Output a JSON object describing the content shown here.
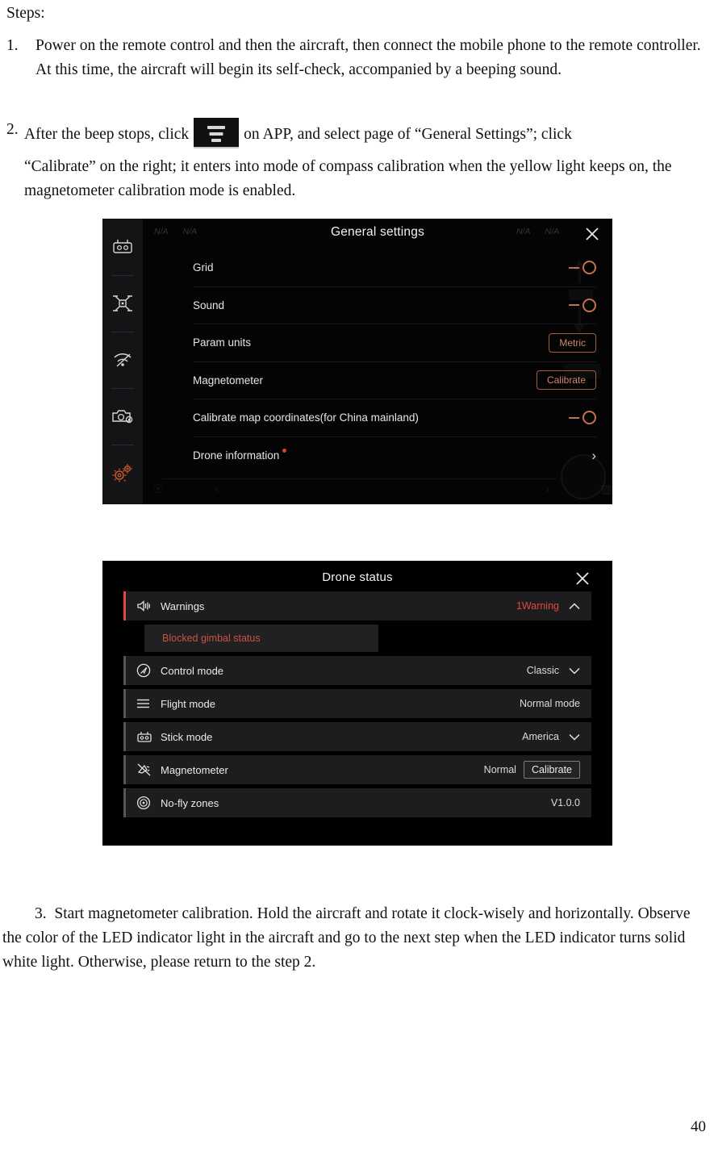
{
  "document": {
    "steps_heading": "Steps:",
    "step1": {
      "number": "1.",
      "text": "Power on the remote control and then the aircraft, then connect the mobile phone to the remote controller. At this time, the aircraft will begin its self-check, accompanied by a beeping sound."
    },
    "step2": {
      "number": "2.",
      "text_before_icon": "After the beep stops, click",
      "icon_name": "app-menu-icon",
      "text_after_icon": "on APP, and select page of “General Settings”; click",
      "line2": "“Calibrate” on the right; it enters into mode of compass calibration when the yellow light keeps on, the magnetometer calibration mode is enabled."
    },
    "step3": {
      "number": "3.",
      "text": "Start magnetometer calibration. Hold the aircraft and rotate it clock-wisely and horizontally. Observe the color of the LED indicator light in the aircraft and go to the next step when the LED indicator turns solid white light. Otherwise, please return to the step 2."
    },
    "page_number": "40"
  },
  "general_settings": {
    "title": "General settings",
    "close_label": "✕",
    "hud": {
      "status_items": [
        "N/A",
        "N/A",
        "N/A",
        "N/A"
      ]
    },
    "sidebar": [
      {
        "name": "remote-controller-icon",
        "active": false
      },
      {
        "name": "aircraft-icon",
        "active": false
      },
      {
        "name": "transmission-icon",
        "active": false
      },
      {
        "name": "camera-settings-icon",
        "active": false
      },
      {
        "name": "general-settings-icon",
        "active": true
      }
    ],
    "rows": [
      {
        "label": "Grid",
        "type": "toggle",
        "value": "off"
      },
      {
        "label": "Sound",
        "type": "toggle",
        "value": "off"
      },
      {
        "label": "Param units",
        "type": "pill",
        "value": "Metric"
      },
      {
        "label": "Magnetometer",
        "type": "pill",
        "value": "Calibrate"
      },
      {
        "label": "Calibrate map coordinates(for China mainland)",
        "type": "toggle",
        "value": "off"
      },
      {
        "label": "Drone information",
        "type": "chevron",
        "value": "›",
        "badge": true
      }
    ],
    "accent_color": "#c4704f",
    "badge_color": "#e23b2e"
  },
  "drone_status": {
    "title": "Drone status",
    "close_label": "✕",
    "rows": [
      {
        "label": "Warnings",
        "icon": "speaker-icon",
        "value": "1Warning",
        "value_color": "red",
        "chevron": "∧",
        "accent": "red"
      },
      {
        "label": "Control mode",
        "icon": "control-mode-icon",
        "value": "Classic",
        "value_color": "normal",
        "chevron": "∨",
        "accent": "gray"
      },
      {
        "label": "Flight mode",
        "icon": "list-icon",
        "value": "Normal mode",
        "value_color": "normal",
        "chevron": "",
        "accent": "gray"
      },
      {
        "label": "Stick mode",
        "icon": "remote-controller-icon",
        "value": "America",
        "value_color": "normal",
        "chevron": "∨",
        "accent": "gray"
      },
      {
        "label": "Magnetometer",
        "icon": "magnetometer-icon",
        "value": "Normal",
        "value_color": "normal",
        "button": "Calibrate",
        "chevron": "",
        "accent": "gray"
      },
      {
        "label": "No-fly zones",
        "icon": "no-fly-zone-icon",
        "value": "V1.0.0",
        "value_color": "normal",
        "chevron": "",
        "accent": "gray"
      }
    ],
    "warning_sub_item": "Blocked gimbal status",
    "warning_color": "#e2483d",
    "sub_item_color": "#c9543f"
  }
}
